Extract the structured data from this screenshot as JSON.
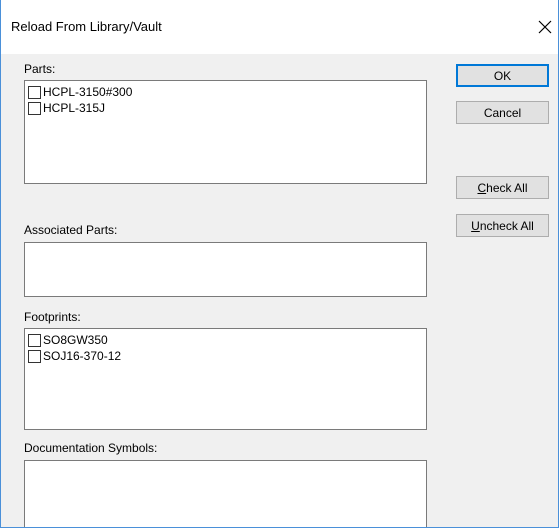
{
  "window": {
    "title": "Reload From Library/Vault"
  },
  "parts": {
    "label": "Parts:",
    "items": [
      {
        "label": "HCPL-3150#300"
      },
      {
        "label": "HCPL-315J"
      }
    ]
  },
  "associated_parts": {
    "label": "Associated Parts:",
    "items": []
  },
  "footprints": {
    "label": "Footprints:",
    "items": [
      {
        "label": "SO8GW350"
      },
      {
        "label": "SOJ16-370-12"
      }
    ]
  },
  "documentation_symbols": {
    "label": "Documentation Symbols:",
    "items": []
  },
  "buttons": {
    "ok": "OK",
    "cancel": "Cancel",
    "check_all": {
      "mnemonic": "C",
      "rest": "heck All"
    },
    "uncheck_all": {
      "mnemonic": "U",
      "rest": "ncheck All"
    }
  }
}
